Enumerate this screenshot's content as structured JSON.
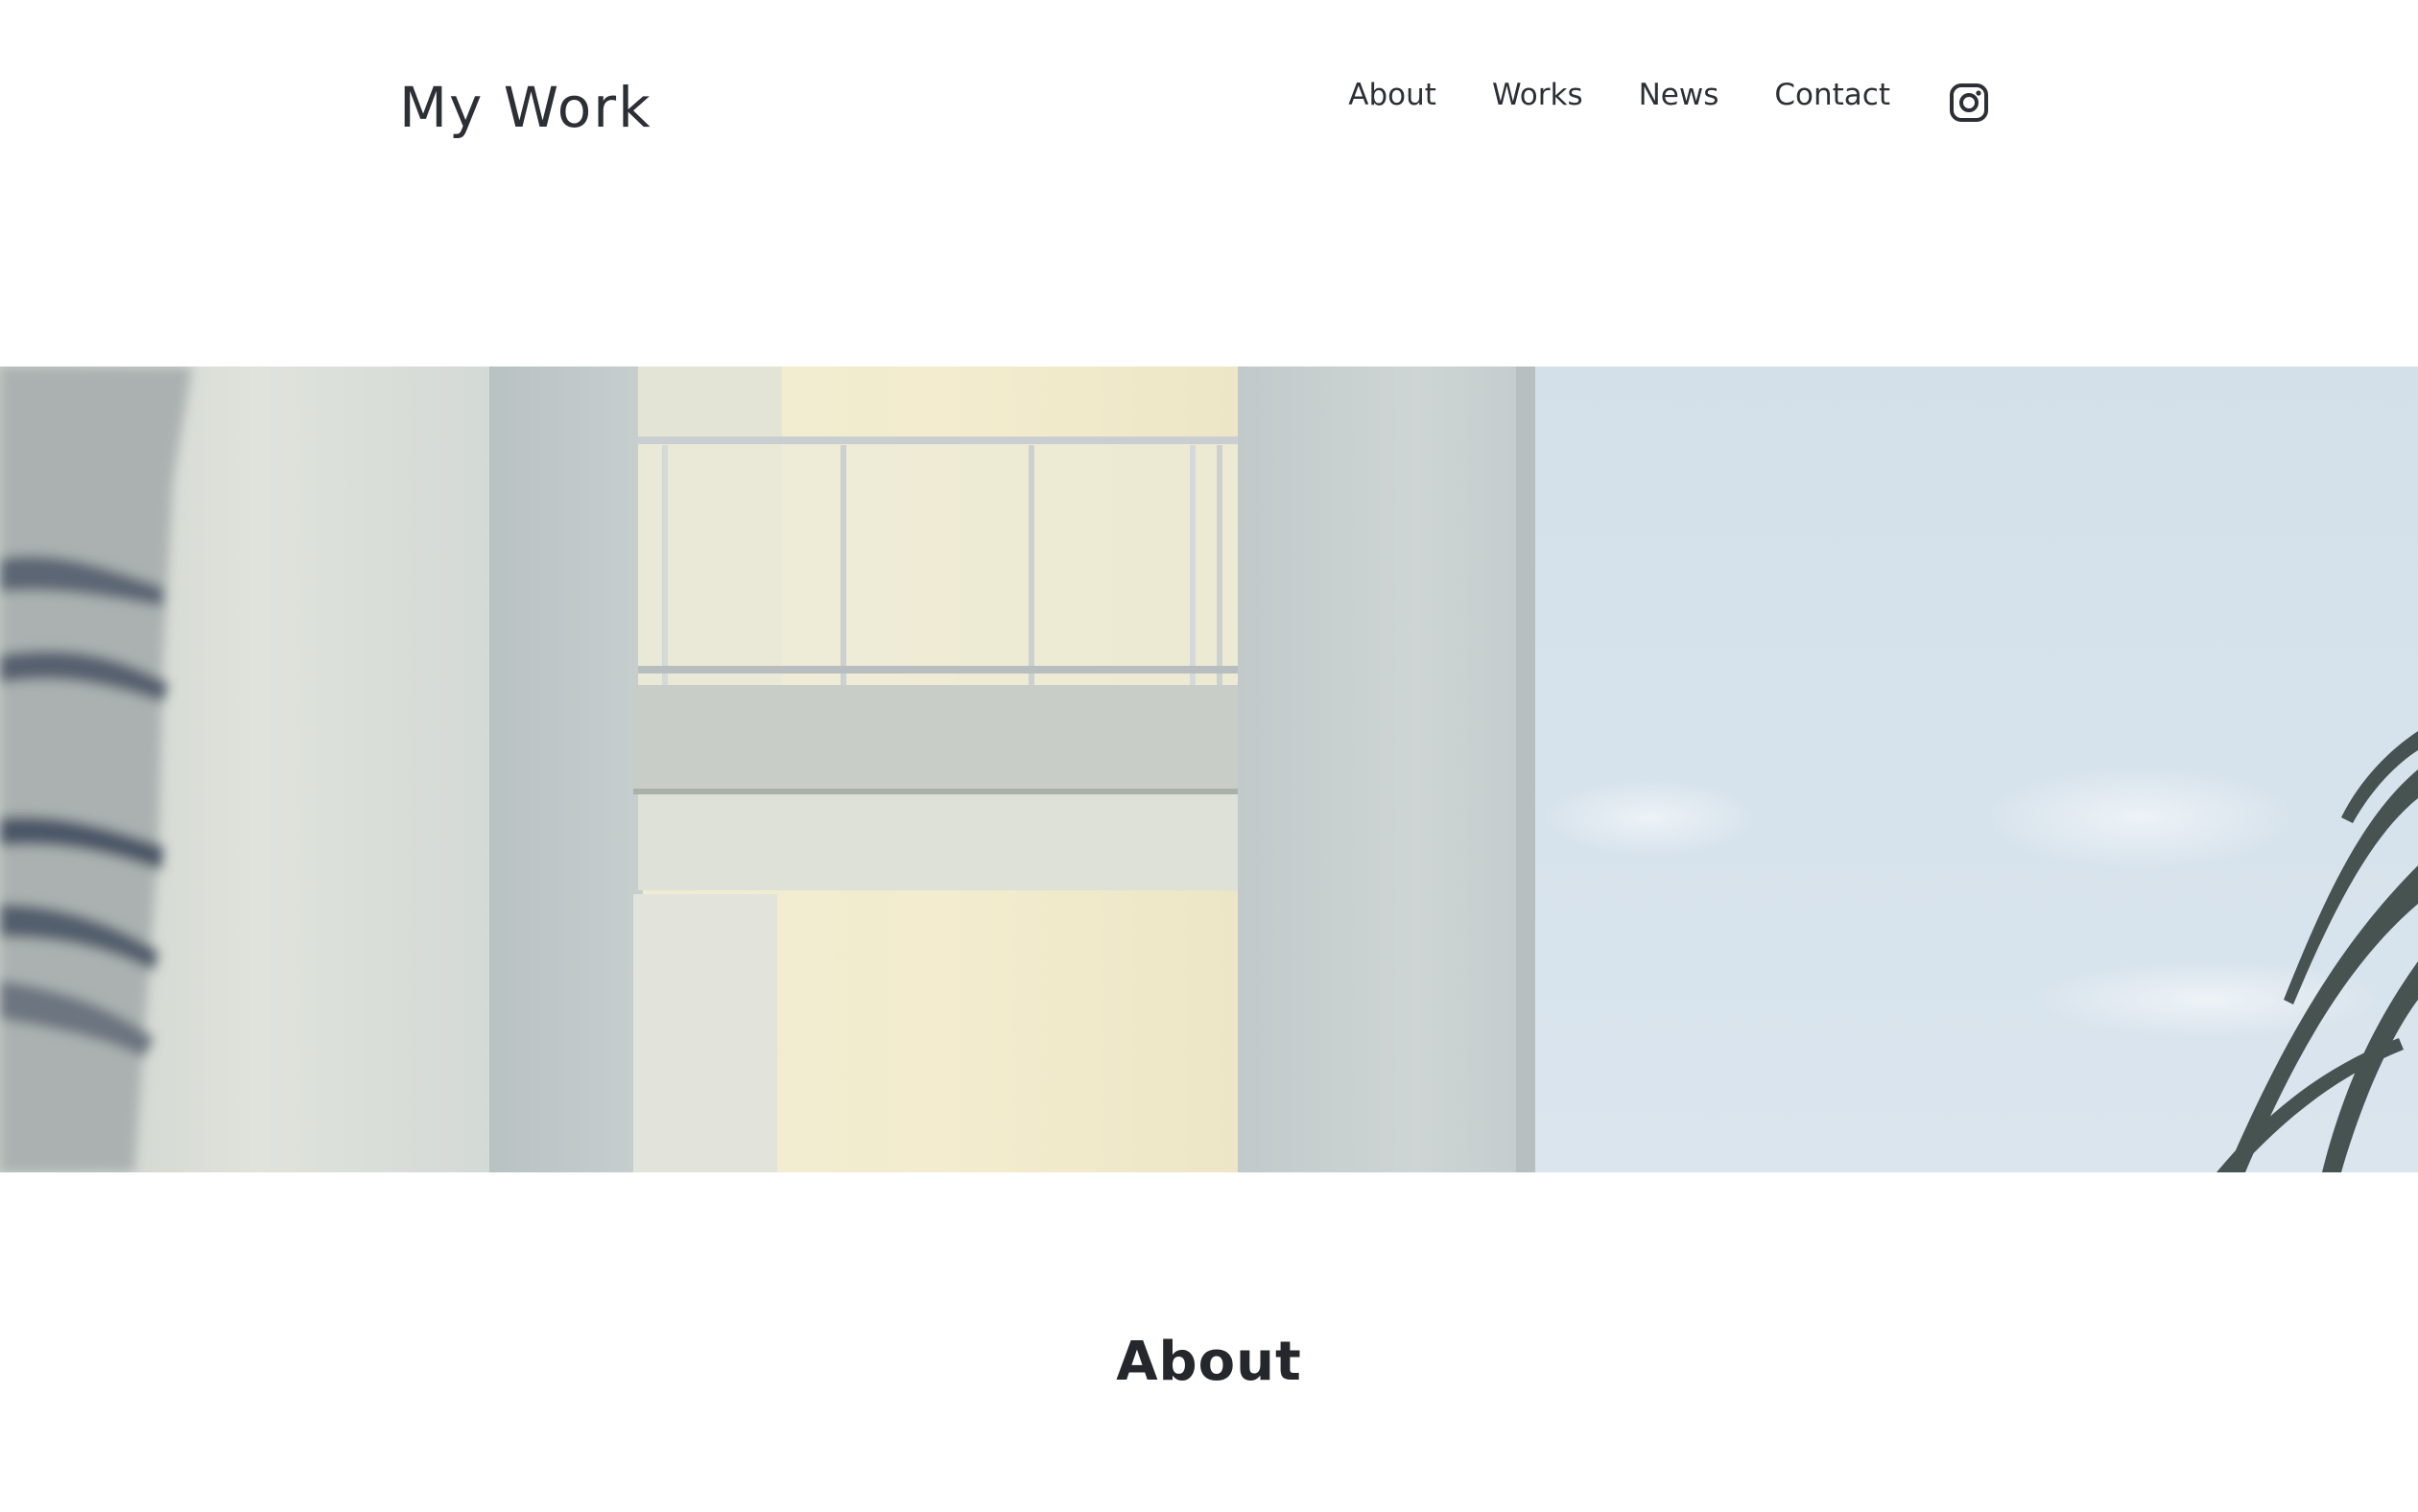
{
  "header": {
    "site_title": "My Work",
    "nav": [
      {
        "label": "About"
      },
      {
        "label": "Works"
      },
      {
        "label": "News"
      },
      {
        "label": "Contact"
      }
    ],
    "social_icon": "instagram-icon"
  },
  "hero": {
    "image": "white-building-balcony-photo"
  },
  "about": {
    "title": "About"
  }
}
